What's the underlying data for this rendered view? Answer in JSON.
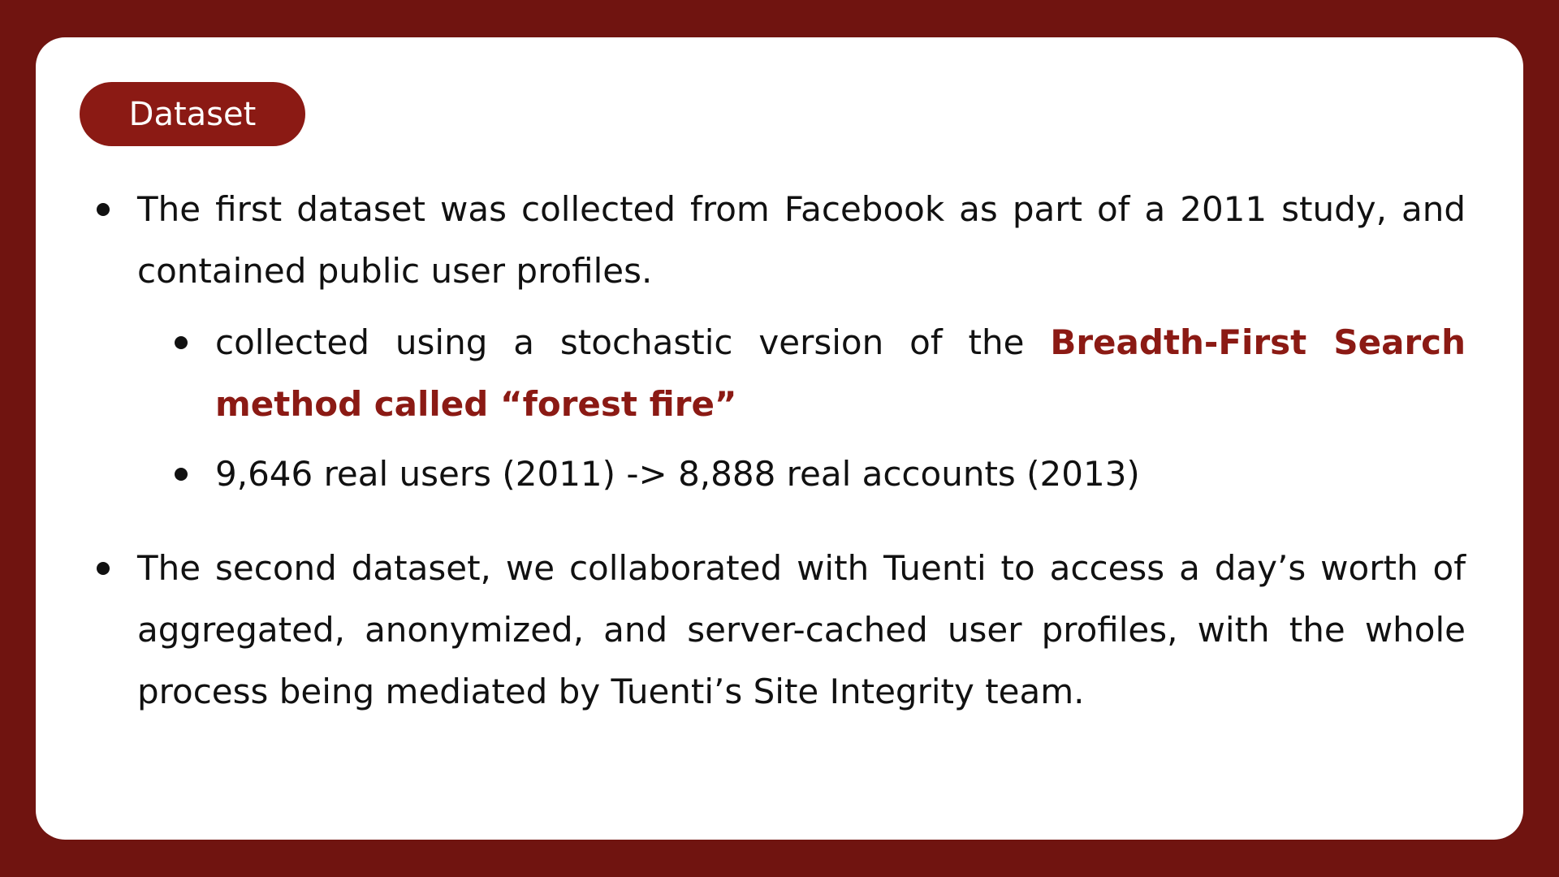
{
  "slide": {
    "section_label": "Dataset",
    "bullets": [
      {
        "text": "The first dataset was collected from Facebook as part of a 2011 study, and contained public user profiles.",
        "subbullets": [
          {
            "prefix": "collected using a stochastic version of the ",
            "highlight": "Breadth-First Search method called “forest fire”"
          },
          {
            "text": "9,646 real users (2011) -> 8,888 real accounts (2013)"
          }
        ]
      },
      {
        "text": "The second dataset, we collaborated with Tuenti to access a day’s worth of aggregated, anonymized, and server-cached user profiles, with the whole process being mediated by Tuenti’s Site Integrity team."
      }
    ]
  },
  "colors": {
    "background": "#701410",
    "accent": "#8b1a14",
    "card": "#ffffff",
    "text": "#111111"
  }
}
